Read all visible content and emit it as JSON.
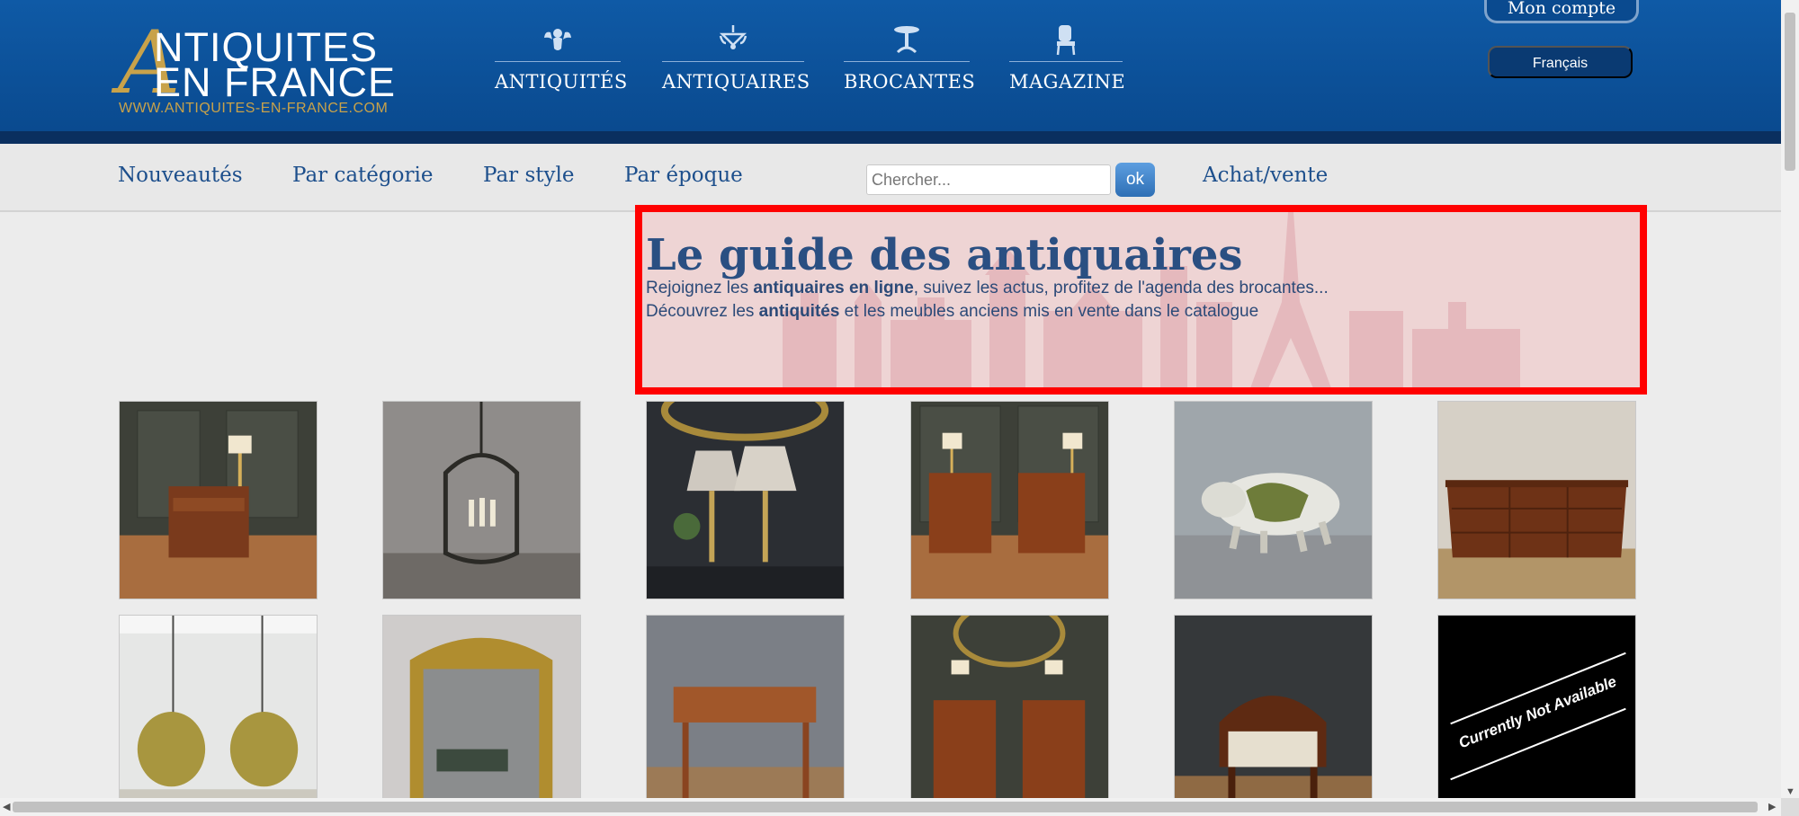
{
  "header": {
    "logo": {
      "big_letter": "A",
      "line1": "NTIQUITES",
      "line2": "EN FRANCE",
      "url": "WWW.ANTIQUITES-EN-FRANCE.COM"
    },
    "nav": [
      {
        "label": "ANTIQUITÉS",
        "icon": "cherub-icon"
      },
      {
        "label": "ANTIQUAIRES",
        "icon": "chandelier-icon"
      },
      {
        "label": "BROCANTES",
        "icon": "pedestal-table-icon"
      },
      {
        "label": "MAGAZINE",
        "icon": "armchair-icon"
      }
    ],
    "account_label": "Mon compte",
    "language_label": "Français"
  },
  "subnav": {
    "links": [
      "Nouveautés",
      "Par catégorie",
      "Par style",
      "Par époque"
    ],
    "search_placeholder": "Chercher...",
    "search_button": "ok",
    "buy_sell": "Achat/vente"
  },
  "intro": {
    "title": "Le guide des antiquaires",
    "line1": {
      "pre": "Rejoignez les ",
      "bold": "antiquaires en ligne",
      "post": ", suivez les actus, profitez de l'agenda des brocantes..."
    },
    "line2": {
      "pre": "Découvrez les ",
      "bold": "antiquités",
      "post": " et les meubles anciens mis en vente dans le catalogue"
    }
  },
  "products": [
    {
      "name": "night-table"
    },
    {
      "name": "lantern-chandelier"
    },
    {
      "name": "pair-of-lamps"
    },
    {
      "name": "pair-of-bedside-tables"
    },
    {
      "name": "ceramic-bull"
    },
    {
      "name": "commode"
    },
    {
      "name": "pair-of-pendant-lights"
    },
    {
      "name": "gilded-mirror"
    },
    {
      "name": "writing-desk"
    },
    {
      "name": "pair-of-side-tables"
    },
    {
      "name": "office-armchair"
    },
    {
      "name": "not-available",
      "overlay_text": "Currently Not Available"
    }
  ],
  "colors": {
    "header_blue": "#0a4a8f",
    "brand_gold": "#c8a24a",
    "link_blue": "#1d4f8c",
    "highlight_red": "#ff0000"
  }
}
